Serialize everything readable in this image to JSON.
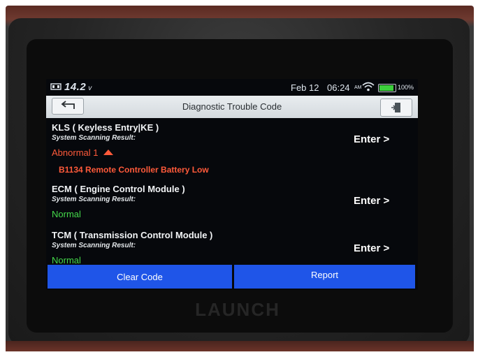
{
  "status_bar": {
    "voltage": "14.2",
    "voltage_unit": "v",
    "date": "Feb 12",
    "time": "06:24",
    "ampm": "AM",
    "battery": "100%",
    "battery_level": 1.0
  },
  "title_bar": {
    "title": "Diagnostic Trouble Code"
  },
  "modules": [
    {
      "name": "KLS ( Keyless Entry|KE )",
      "scan_label": "System Scanning Result:",
      "status": "Abnormal 1",
      "status_type": "abnormal",
      "dtc": "B1134 Remote Controller Battery Low",
      "enter": "Enter >"
    },
    {
      "name": "ECM ( Engine Control Module )",
      "scan_label": "System Scanning Result:",
      "status": "Normal",
      "status_type": "normal",
      "enter": "Enter >"
    },
    {
      "name": "TCM ( Transmission Control Module )",
      "scan_label": "System Scanning Result:",
      "status": "Normal",
      "status_type": "normal",
      "enter": "Enter >"
    }
  ],
  "footer": {
    "clear_code": "Clear Code",
    "report": "Report"
  },
  "device": {
    "brand": "LAUNCH"
  },
  "colors": {
    "abnormal": "#ff5a3a",
    "normal": "#44d94a",
    "button": "#1f55e8"
  }
}
